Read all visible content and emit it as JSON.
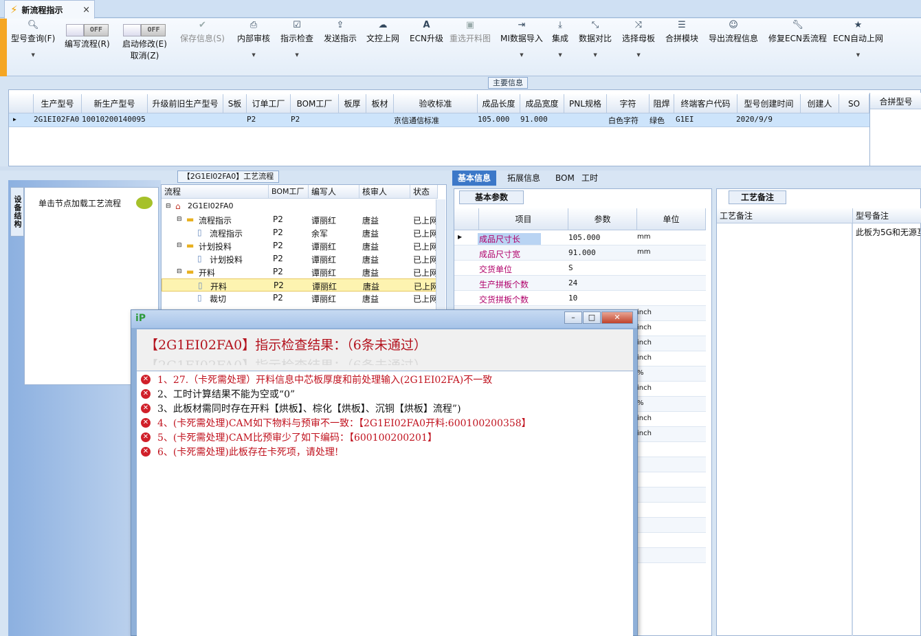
{
  "window_tab": {
    "title": "新流程指示",
    "close": "×"
  },
  "toolbar": {
    "items": [
      {
        "id": "model_query",
        "label": "型号查询(F)",
        "icon": "search-icon"
      },
      {
        "id": "edit_flow",
        "label": "编写流程(R)",
        "toggle": "OFF"
      },
      {
        "id": "start_modify",
        "label": "启动修改(E)",
        "label2": "取消(Z)",
        "toggle": "OFF"
      },
      {
        "id": "save_info",
        "label": "保存信息(S)",
        "icon": "check-icon",
        "disabled": true
      },
      {
        "id": "internal_review",
        "label": "内部审核",
        "icon": "printer-icon"
      },
      {
        "id": "instruct_check",
        "label": "指示检查",
        "icon": "checkbox-icon"
      },
      {
        "id": "send_instruct",
        "label": "发送指示",
        "icon": "upload-icon"
      },
      {
        "id": "cam_upload",
        "label": "文控上网",
        "icon": "cloud-upload-icon"
      },
      {
        "id": "ecn_upgrade",
        "label": "ECN升级",
        "icon": "font-icon"
      },
      {
        "id": "reselect_chart",
        "label": "重选开料图",
        "icon": "image-icon",
        "disabled": true
      },
      {
        "id": "mi_import",
        "label": "MI数据导入",
        "icon": "sign-in-icon"
      },
      {
        "id": "integrate",
        "label": "集成",
        "icon": "download-icon"
      },
      {
        "id": "data_compare",
        "label": "数据对比",
        "icon": "compress-icon"
      },
      {
        "id": "select_mother",
        "label": "选择母板",
        "icon": "shuffle-icon"
      },
      {
        "id": "merge_module",
        "label": "合拼模块",
        "icon": "list-icon"
      },
      {
        "id": "export_flow",
        "label": "导出流程信息",
        "icon": "smile-icon"
      },
      {
        "id": "repair_ecn",
        "label": "修复ECN丢流程",
        "icon": "wrench-icon"
      },
      {
        "id": "ecn_auto",
        "label": "ECN自动上网",
        "icon": "star-icon"
      }
    ]
  },
  "main_info": {
    "header": "主要信息",
    "columns": [
      "生产型号",
      "新生产型号",
      "升级前旧生产型号",
      "S板",
      "订单工厂",
      "BOM工厂",
      "板厚",
      "板材",
      "验收标准",
      "成品长度",
      "成品宽度",
      "PNL规格",
      "字符",
      "阻焊",
      "终端客户代码",
      "型号创建时间",
      "创建人",
      "SO"
    ],
    "merge_column": "合拼型号",
    "row": {
      "生产型号": "2G1EI02FA0",
      "新生产型号": "10010200140095",
      "订单工厂": "P2",
      "BOM工厂": "P2",
      "验收标准": "京信通信标准",
      "成品长度": "105.000",
      "成品宽度": "91.000",
      "字符": "白色字符",
      "阻焊": "绿色",
      "终端客户代码": "G1EI",
      "型号创建时间": "2020/9/9"
    }
  },
  "left_panel": {
    "vertical_tab": "设备结构",
    "hint": "单击节点加载工艺流程"
  },
  "flow": {
    "header": "【2G1EI02FA0】工艺流程",
    "columns": [
      "流程",
      "BOM工厂",
      "编写人",
      "核审人",
      "状态"
    ],
    "rows": [
      {
        "name": "2G1EI02FA0",
        "indent": 0,
        "type": "root",
        "bom": "",
        "writer": "",
        "reviewer": "",
        "status": ""
      },
      {
        "name": "流程指示",
        "indent": 1,
        "type": "folder",
        "bom": "P2",
        "writer": "谭丽红",
        "reviewer": "唐益",
        "status": "已上网"
      },
      {
        "name": "流程指示",
        "indent": 2,
        "type": "file",
        "bom": "P2",
        "writer": "余军",
        "reviewer": "唐益",
        "status": "已上网"
      },
      {
        "name": "计划投料",
        "indent": 1,
        "type": "folder",
        "bom": "P2",
        "writer": "谭丽红",
        "reviewer": "唐益",
        "status": "已上网"
      },
      {
        "name": "计划投料",
        "indent": 2,
        "type": "file",
        "bom": "P2",
        "writer": "谭丽红",
        "reviewer": "唐益",
        "status": "已上网"
      },
      {
        "name": "开料",
        "indent": 1,
        "type": "folder",
        "bom": "P2",
        "writer": "谭丽红",
        "reviewer": "唐益",
        "status": "已上网"
      },
      {
        "name": "开料",
        "indent": 2,
        "type": "file",
        "bom": "P2",
        "writer": "谭丽红",
        "reviewer": "唐益",
        "status": "已上网",
        "selected": true
      },
      {
        "name": "裁切",
        "indent": 2,
        "type": "file",
        "bom": "P2",
        "writer": "谭丽红",
        "reviewer": "唐益",
        "status": "已上网"
      }
    ]
  },
  "right_tabs": [
    "基本信息",
    "拓展信息",
    "BOM",
    "工时"
  ],
  "params": {
    "tab": "基本参数",
    "columns": [
      "项目",
      "参数",
      "单位"
    ],
    "rows": [
      {
        "k": "成品尺寸长",
        "v": "105.000",
        "u": "mm"
      },
      {
        "k": "成品尺寸宽",
        "v": "91.000",
        "u": "mm"
      },
      {
        "k": "交货单位",
        "v": "S",
        "u": ""
      },
      {
        "k": "生产拼板个数",
        "v": "24",
        "u": ""
      },
      {
        "k": "交货拼板个数",
        "v": "10",
        "u": ""
      }
    ],
    "partial_units": [
      "inch",
      "inch",
      "inch",
      "inch",
      "%",
      "inch",
      "%",
      "inch",
      "inch"
    ]
  },
  "notes": {
    "tab": "工艺备注",
    "col1": "工艺备注",
    "col2": "型号备注",
    "col2_value": "此板为5G和无源互"
  },
  "dialog": {
    "heading": "【2G1EI02FA0】指示检查结果：（6条未通过）",
    "messages": [
      {
        "text": "1、27.（卡死需处理）开料信息中芯板厚度和前处理输入(2G1EI02FA)不一致",
        "color": "red"
      },
      {
        "text": "2、工时计算结果不能为空或“0”",
        "color": "black"
      },
      {
        "text": "3、此板材需同时存在开料【烘板】、棕化【烘板】、沉铜【烘板】流程”)",
        "color": "black"
      },
      {
        "text": "4、(卡死需处理)CAM如下物料与预审不一致：【2G1EI02FA0开料:600100200358】",
        "color": "red"
      },
      {
        "text": "5、(卡死需处理)CAM比预审少了如下编码：【600100200201】",
        "color": "red"
      },
      {
        "text": "6、(卡死需处理)此板存在卡死项，请处理!",
        "color": "red"
      }
    ]
  }
}
